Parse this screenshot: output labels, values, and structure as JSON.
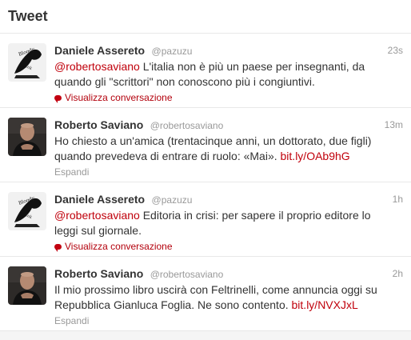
{
  "header": {
    "title": "Tweet"
  },
  "tweets": [
    {
      "fullname": "Daniele Assereto",
      "username": "@pazuzu",
      "time": "23s",
      "mention": "@robertosaviano",
      "text_before": "",
      "text_after": " L'italia non è più un paese per insegnanti, da quando gli \"scrittori\" non conoscono più i congiuntivi.",
      "link": "",
      "action": "Visualizza conversazione",
      "action_type": "conversation"
    },
    {
      "fullname": "Roberto Saviano",
      "username": "@robertosaviano",
      "time": "13m",
      "mention": "",
      "text_before": "Ho chiesto a un'amica (trentacinque anni, un dottorato, due figli) quando prevedeva di entrare di ruolo: «Mai». ",
      "text_after": "",
      "link": "bit.ly/OAb9hG",
      "action": "Espandi",
      "action_type": "expand"
    },
    {
      "fullname": "Daniele Assereto",
      "username": "@pazuzu",
      "time": "1h",
      "mention": "@robertosaviano",
      "text_before": "",
      "text_after": " Editoria in crisi: per sapere il proprio editore lo leggi sul giornale.",
      "link": "",
      "action": "Visualizza conversazione",
      "action_type": "conversation"
    },
    {
      "fullname": "Roberto Saviano",
      "username": "@robertosaviano",
      "time": "2h",
      "mention": "",
      "text_before": "Il mio prossimo libro uscirà con Feltrinelli, come annuncia oggi su Repubblica Gianluca Foglia. Ne sono contento. ",
      "text_after": "",
      "link": "bit.ly/NVXJxL",
      "action": "Espandi",
      "action_type": "expand"
    }
  ]
}
